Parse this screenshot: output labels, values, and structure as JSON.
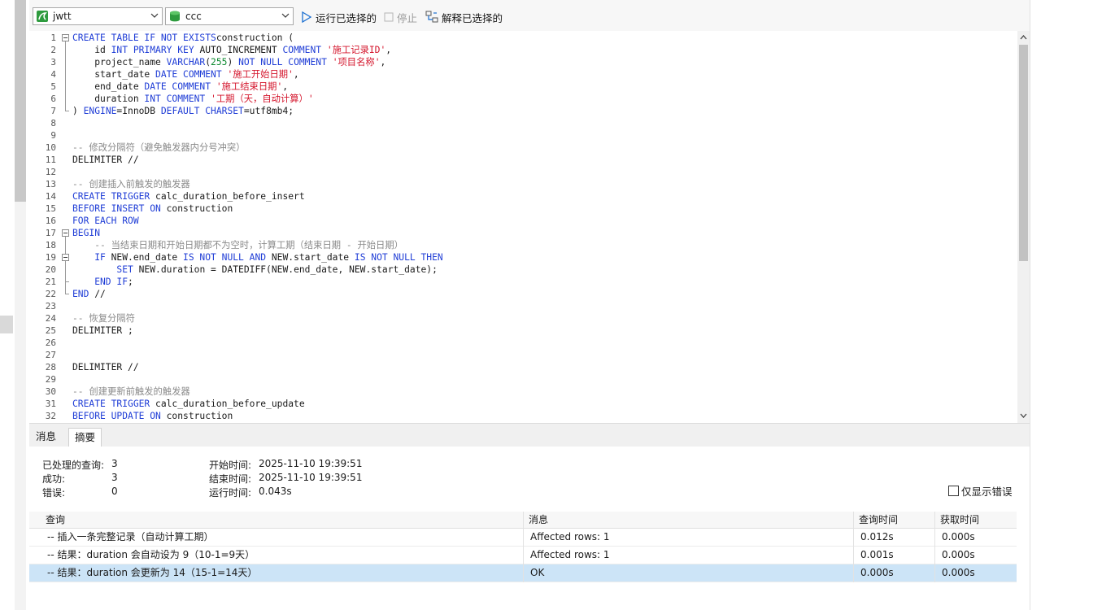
{
  "toolbar": {
    "connection": "jwtt",
    "database": "ccc",
    "run_selected": "运行已选择的",
    "stop": "停止",
    "explain_selected": "解释已选择的"
  },
  "editor": {
    "line_numbers": [
      "1",
      "2",
      "3",
      "4",
      "5",
      "6",
      "7",
      "8",
      "9",
      "10",
      "11",
      "12",
      "13",
      "14",
      "15",
      "16",
      "17",
      "18",
      "19",
      "20",
      "21",
      "22",
      "23",
      "24",
      "25",
      "26",
      "27",
      "28",
      "29",
      "30",
      "31",
      "32"
    ],
    "lines": [
      {
        "t": [
          [
            "kw",
            "CREATE TABLE IF NOT EXISTS"
          ],
          [
            "",
            "construction ("
          ]
        ]
      },
      {
        "t": [
          [
            "",
            "    id "
          ],
          [
            "kw",
            "INT PRIMARY KEY"
          ],
          [
            "",
            " AUTO_INCREMENT "
          ],
          [
            "kw",
            "COMMENT"
          ],
          [
            "",
            " "
          ],
          [
            "str",
            "'施工记录ID'"
          ],
          [
            "",
            ","
          ]
        ]
      },
      {
        "t": [
          [
            "",
            "    project_name "
          ],
          [
            "kw",
            "VARCHAR"
          ],
          [
            "",
            "("
          ],
          [
            "num",
            "255"
          ],
          [
            "",
            ") "
          ],
          [
            "kw",
            "NOT NULL COMMENT"
          ],
          [
            "",
            " "
          ],
          [
            "str",
            "'项目名称'"
          ],
          [
            "",
            ","
          ]
        ]
      },
      {
        "t": [
          [
            "",
            "    start_date "
          ],
          [
            "kw",
            "DATE COMMENT"
          ],
          [
            "",
            " "
          ],
          [
            "str",
            "'施工开始日期'"
          ],
          [
            "",
            ","
          ]
        ]
      },
      {
        "t": [
          [
            "",
            "    end_date "
          ],
          [
            "kw",
            "DATE COMMENT"
          ],
          [
            "",
            " "
          ],
          [
            "str",
            "'施工结束日期'"
          ],
          [
            "",
            ","
          ]
        ]
      },
      {
        "t": [
          [
            "",
            "    duration "
          ],
          [
            "kw",
            "INT COMMENT"
          ],
          [
            "",
            " "
          ],
          [
            "str",
            "'工期（天，自动计算）'"
          ]
        ]
      },
      {
        "t": [
          [
            "",
            ") "
          ],
          [
            "kw",
            "ENGINE"
          ],
          [
            "",
            "=InnoDB "
          ],
          [
            "kw",
            "DEFAULT CHARSET"
          ],
          [
            "",
            "=utf8mb4;"
          ]
        ]
      },
      {
        "t": []
      },
      {
        "t": []
      },
      {
        "t": [
          [
            "cm",
            "-- 修改分隔符（避免触发器内分号冲突）"
          ]
        ]
      },
      {
        "t": [
          [
            "",
            "DELIMITER //"
          ]
        ]
      },
      {
        "t": []
      },
      {
        "t": [
          [
            "cm",
            "-- 创建插入前触发的触发器"
          ]
        ]
      },
      {
        "t": [
          [
            "kw",
            "CREATE TRIGGER"
          ],
          [
            "",
            " calc_duration_before_insert"
          ]
        ]
      },
      {
        "t": [
          [
            "kw",
            "BEFORE INSERT ON"
          ],
          [
            "",
            " construction"
          ]
        ]
      },
      {
        "t": [
          [
            "kw",
            "FOR EACH ROW"
          ]
        ]
      },
      {
        "t": [
          [
            "kw",
            "BEGIN"
          ]
        ]
      },
      {
        "t": [
          [
            "cm",
            "    -- 当结束日期和开始日期都不为空时，计算工期（结束日期 - 开始日期）"
          ]
        ]
      },
      {
        "t": [
          [
            "kw",
            "    IF"
          ],
          [
            "",
            " NEW.end_date "
          ],
          [
            "kw",
            "IS NOT NULL AND"
          ],
          [
            "",
            " NEW.start_date "
          ],
          [
            "kw",
            "IS NOT NULL THEN"
          ]
        ]
      },
      {
        "t": [
          [
            "kw",
            "        SET"
          ],
          [
            "",
            " NEW.duration = DATEDIFF(NEW.end_date, NEW.start_date);"
          ]
        ]
      },
      {
        "t": [
          [
            "kw",
            "    END IF"
          ],
          [
            "",
            ";"
          ]
        ]
      },
      {
        "t": [
          [
            "kw",
            "END"
          ],
          [
            "",
            " //"
          ]
        ]
      },
      {
        "t": []
      },
      {
        "t": [
          [
            "cm",
            "-- 恢复分隔符"
          ]
        ]
      },
      {
        "t": [
          [
            "",
            "DELIMITER ;"
          ]
        ]
      },
      {
        "t": []
      },
      {
        "t": []
      },
      {
        "t": [
          [
            "",
            "DELIMITER //"
          ]
        ]
      },
      {
        "t": []
      },
      {
        "t": [
          [
            "cm",
            "-- 创建更新前触发的触发器"
          ]
        ]
      },
      {
        "t": [
          [
            "kw",
            "CREATE TRIGGER"
          ],
          [
            "",
            " calc_duration_before_update"
          ]
        ]
      },
      {
        "t": [
          [
            "kw",
            "BEFORE UPDATE ON"
          ],
          [
            "",
            " construction"
          ]
        ]
      }
    ]
  },
  "tabs": [
    "消息",
    "摘要"
  ],
  "summary": {
    "processed_label": "已处理的查询:",
    "processed_value": "3",
    "success_label": "成功:",
    "success_value": "3",
    "error_label": "错误:",
    "error_value": "0",
    "start_label": "开始时间:",
    "start_value": "2025-11-10 19:39:51",
    "end_label": "结束时间:",
    "end_value": "2025-11-10 19:39:51",
    "run_label": "运行时间:",
    "run_value": "0.043s",
    "errors_only": "仅显示错误"
  },
  "results": {
    "columns": [
      "查询",
      "消息",
      "查询时间",
      "获取时间"
    ],
    "rows": [
      {
        "query": "-- 插入一条完整记录（自动计算工期）",
        "message": "Affected rows: 1",
        "query_time": "0.012s",
        "fetch_time": "0.000s"
      },
      {
        "query": "-- 结果：duration 会自动设为 9（10-1=9天）",
        "message": "Affected rows: 1",
        "query_time": "0.001s",
        "fetch_time": "0.000s"
      },
      {
        "query": "-- 结果：duration 会更新为 14（15-1=14天）",
        "message": "OK",
        "query_time": "0.000s",
        "fetch_time": "0.000s"
      }
    ]
  },
  "colors": {
    "keyword": "#1f3dd6",
    "string": "#d4142b",
    "number": "#0d8a2f",
    "comment": "#8a8a8a",
    "selected_row": "#cce4f7"
  }
}
